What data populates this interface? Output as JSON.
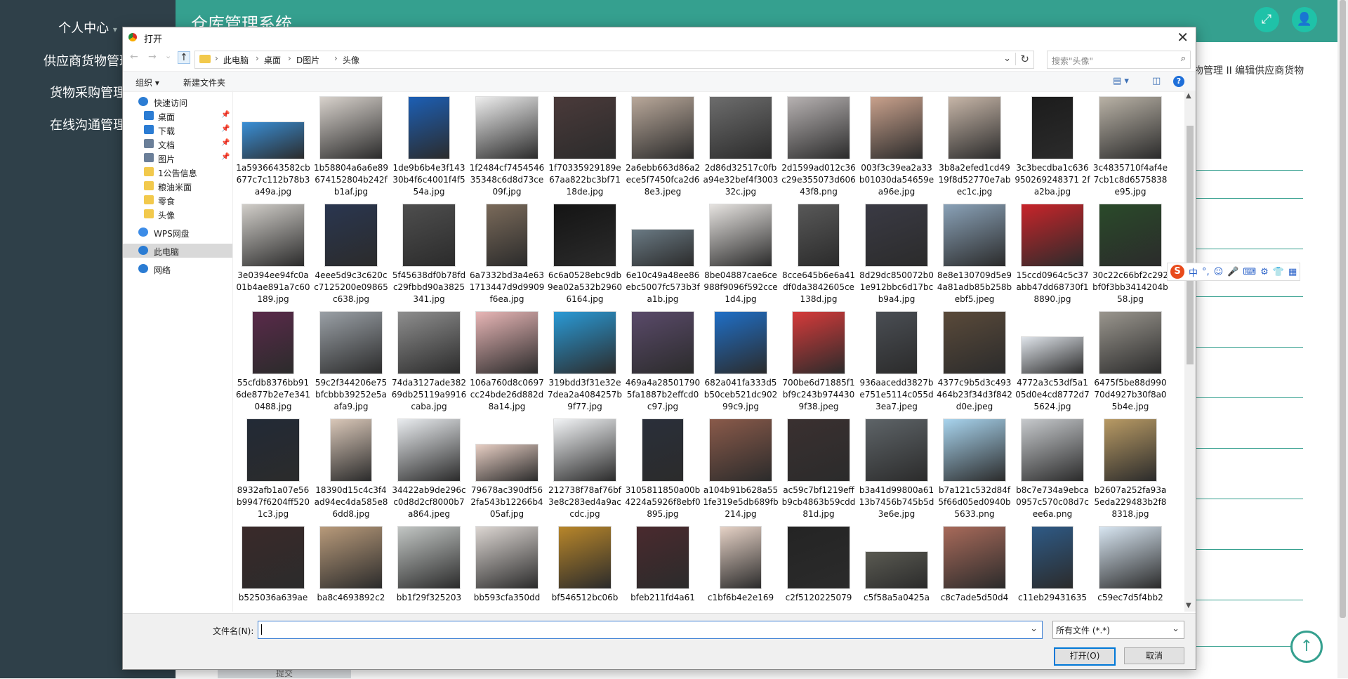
{
  "app": {
    "title": "仓库管理系统",
    "menu": [
      "个人中心",
      "供应商货物管理",
      "货物采购管理",
      "在线沟通管理"
    ],
    "menu_caret": "▾",
    "breadcrumb_tail": "物管理 II 编辑供应商货物",
    "submit_label": "提交",
    "fullscreen_icon": "⤢",
    "user_icon": "👤",
    "up_icon": "↑"
  },
  "dialog": {
    "title": "打开",
    "close": "✕",
    "nav": {
      "back": "←",
      "forward": "→",
      "recent": "⌄",
      "up": "↑"
    },
    "breadcrumb": [
      "此电脑",
      "桌面",
      "D图片",
      "头像"
    ],
    "breadcrumb_sep": "›",
    "addr_dropdown": "⌄",
    "refresh": "↻",
    "search_placeholder": "搜索\"头像\"",
    "search_icon": "⌕",
    "organize": "组织 ▾",
    "new_folder": "新建文件夹",
    "view_icon": "▤ ▾",
    "pane_icon": "◫",
    "help": "?",
    "nav_pane": [
      {
        "label": "快速访问",
        "color": "#2b7cd3",
        "indent": 0,
        "pin": false
      },
      {
        "label": "桌面",
        "color": "#2b7cd3",
        "indent": 1,
        "pin": true
      },
      {
        "label": "下载",
        "color": "#2b7cd3",
        "indent": 1,
        "pin": true
      },
      {
        "label": "文档",
        "color": "#6b7f99",
        "indent": 1,
        "pin": true
      },
      {
        "label": "图片",
        "color": "#6b7f99",
        "indent": 1,
        "pin": true
      },
      {
        "label": "1公告信息",
        "color": "#f2c94c",
        "indent": 1,
        "pin": false
      },
      {
        "label": "粮油米面",
        "color": "#f2c94c",
        "indent": 1,
        "pin": false
      },
      {
        "label": "零食",
        "color": "#f2c94c",
        "indent": 1,
        "pin": false
      },
      {
        "label": "头像",
        "color": "#f2c94c",
        "indent": 1,
        "pin": false
      },
      {
        "label": "WPS网盘",
        "color": "#3c8ce7",
        "indent": 0,
        "pin": false
      },
      {
        "label": "此电脑",
        "color": "#2b7cd3",
        "indent": 0,
        "pin": false
      },
      {
        "label": "网络",
        "color": "#2b7cd3",
        "indent": 0,
        "pin": false
      }
    ],
    "pin_icon": "📌",
    "files": [
      {
        "name": "1a5936643582cb677c7c112b78b3a49a.jpg",
        "color": "#3a8fd6"
      },
      {
        "name": "1b58804a6a6e89674152804b242fb1af.jpg",
        "color": "#d8d2cc"
      },
      {
        "name": "1de9b6b4e3f14330b4f6c4001f4f554a.jpg",
        "color": "#1c5fb5"
      },
      {
        "name": "1f2484cf745454635348c6d8d73ce09f.jpg",
        "color": "#eeeeee"
      },
      {
        "name": "1f70335929189e67aa822bc3bf7118de.jpg",
        "color": "#4a3a3a"
      },
      {
        "name": "2a6ebb663d86a2ece5f7450fca2d68e3.jpeg",
        "color": "#b9a89a"
      },
      {
        "name": "2d86d32517c0fba94e32bef4f300332c.jpg",
        "color": "#6d6d6d"
      },
      {
        "name": "2d1599ad012c36c29e355073d60643f8.png",
        "color": "#b7b2b2"
      },
      {
        "name": "003f3c39ea2a33b01030da54659ea96e.jpg",
        "color": "#c9a18c"
      },
      {
        "name": "3b8a2efed1cd4919f8d52770e7abec1c.jpg",
        "color": "#c7b6a8"
      },
      {
        "name": "3c3becdba1c636950269248371 2fa2ba.jpg",
        "color": "#1c1c1c"
      },
      {
        "name": "3c4835710f4af4e7cb1c8d6575838e95.jpg",
        "color": "#b9b2a6"
      },
      {
        "name": "3e0394ee94fc0a01b4ae891a7c60189.jpg",
        "color": "#d1cec9"
      },
      {
        "name": "4eee5d9c3c620cc7125200e09865c638.jpg",
        "color": "#2a3650"
      },
      {
        "name": "5f45638df0b78fdc29fbbd90a3825341.jpg",
        "color": "#4e4e4e"
      },
      {
        "name": "6a7332bd3a4e631713447d9d9909f6ea.jpg",
        "color": "#7a6a5a"
      },
      {
        "name": "6c6a0528ebc9db9ea02a532b29606164.jpg",
        "color": "#141414"
      },
      {
        "name": "6e10c49a48ee86ebc5007fc573b3fa1b.jpg",
        "color": "#6a7a84"
      },
      {
        "name": "8be04887cae6ce988f9096f592cce1d4.jpg",
        "color": "#e6e3e0"
      },
      {
        "name": "8cce645b6e6a41df0da3842605ce138d.jpg",
        "color": "#585858"
      },
      {
        "name": "8d29dc850072b01e912bbc6d17bcb9a4.jpg",
        "color": "#3a3a44"
      },
      {
        "name": "8e8e130709d5e94a81adb85b258bebf5.jpeg",
        "color": "#8aa2b8"
      },
      {
        "name": "15ccd0964c5c37abb47dd68730f18890.jpg",
        "color": "#c8242a"
      },
      {
        "name": "30c22c66bf2c292bf0f3bb3414204b58.jpg",
        "color": "#2a4a2a"
      },
      {
        "name": "55cfdb8376bb916de877b2e7e3410488.jpg",
        "color": "#5a2a4a"
      },
      {
        "name": "59c2f344206e75bfcbbb39252e5aafa9.jpg",
        "color": "#9aa0a6"
      },
      {
        "name": "74da3127ade38269db25119a9916caba.jpg",
        "color": "#8e8e8e"
      },
      {
        "name": "106a760d8c0697cc24bde26d882d8a14.jpg",
        "color": "#e8b6b6"
      },
      {
        "name": "319bdd3f31e32e7dea2a4084257b9f77.jpg",
        "color": "#2a9ad6"
      },
      {
        "name": "469a4a285017905fa1887b2effcd0c97.jpg",
        "color": "#5a4a6a"
      },
      {
        "name": "682a041fa333d5b50ceb521dc90299c9.jpg",
        "color": "#1f6fc7"
      },
      {
        "name": "700be6d71885f1bf9c243b9744309f38.jpeg",
        "color": "#d63a3a"
      },
      {
        "name": "936aacedd3827be751e5114c055d3ea7.jpeg",
        "color": "#4a4e54"
      },
      {
        "name": "4377c9b5d3c493464b23f34d3f842d0e.jpeg",
        "color": "#5a4a3a"
      },
      {
        "name": "4772a3c53df5a105d0e4cd8772d75624.jpg",
        "color": "#dfe4ea"
      },
      {
        "name": "6475f5be88d99070d4927b30f8a05b4e.jpg",
        "color": "#9a968e"
      },
      {
        "name": "8932afb1a07e56b9947f6204ff5201c3.jpg",
        "color": "#222a36"
      },
      {
        "name": "18390d15c4c3f4ad94ec4da585e86dd8.jpg",
        "color": "#d9c7b8"
      },
      {
        "name": "34422ab9de296cc0d8d2cf8000b7a864.jpeg",
        "color": "#e9ecef"
      },
      {
        "name": "79678ac390df562fa543b12266b405af.jpg",
        "color": "#e8cfc4"
      },
      {
        "name": "212738f78af76bf3e8c283ed4a9accdc.jpg",
        "color": "#f2f4f6"
      },
      {
        "name": "3105811850a00b4224a5926f8ebf0895.jpg",
        "color": "#2a2f3a"
      },
      {
        "name": "a104b91b628a551fe319e5db689fb214.jpg",
        "color": "#8a5a4a"
      },
      {
        "name": "ac59c7bf1219effb9cb4863b59cdd81d.jpg",
        "color": "#3a3030"
      },
      {
        "name": "b3a41d99800a6113b7456b745b5d3e6e.jpg",
        "color": "#5e6468"
      },
      {
        "name": "b7a121c532d84f5f66d05ed0940b5633.png",
        "color": "#a8d4ee"
      },
      {
        "name": "b8c7e734a9ebca0957c570c08d7cee6a.png",
        "color": "#c6c9cc"
      },
      {
        "name": "b2607a252fa93a5eda229483b2f88318.jpg",
        "color": "#b89a64"
      },
      {
        "name": "b525036a639ae",
        "color": "#3a2a2a"
      },
      {
        "name": "ba8c4693892c2",
        "color": "#b89a7a"
      },
      {
        "name": "bb1f29f325203",
        "color": "#c2c6c4"
      },
      {
        "name": "bb593cfa350dd",
        "color": "#dcd6d2"
      },
      {
        "name": "bf546512bc06b",
        "color": "#b8862a"
      },
      {
        "name": "bfeb211fd4a61",
        "color": "#4a2a2e"
      },
      {
        "name": "c1bf6b4e2e169",
        "color": "#e6d2c6"
      },
      {
        "name": "c2f5120225079",
        "color": "#242424"
      },
      {
        "name": "c5f58a5a0425a",
        "color": "#5a5a52"
      },
      {
        "name": "c8c7ade5d50d4",
        "color": "#a86a5a"
      },
      {
        "name": "c11eb29431635",
        "color": "#2e5a86"
      },
      {
        "name": "c59ec7d5f4bb2",
        "color": "#d8e6f2"
      }
    ],
    "filename_label": "文件名(N):",
    "filename_value": "",
    "filename_dropdown": "⌄",
    "filter_value": "所有文件 (*.*)",
    "filter_dropdown": "⌄",
    "open_button": "打开(O)",
    "cancel_button": "取消",
    "scroll_up": "▲",
    "scroll_down": "▼"
  },
  "ime": {
    "logo": "S",
    "items": [
      "中",
      "°,",
      "☺",
      "🎤",
      "⌨",
      "⚙",
      "👕",
      "▦"
    ]
  }
}
